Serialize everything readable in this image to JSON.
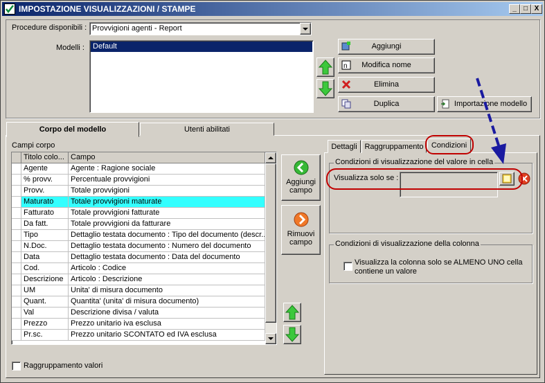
{
  "window": {
    "title": "IMPOSTAZIONE VISUALIZZAZIONI / STAMPE",
    "minimize": "_",
    "maximize": "□",
    "close": "X"
  },
  "top": {
    "procedure_label": "Procedure disponibili :",
    "procedure_value": "Provvigioni agenti - Report",
    "models_label": "Modelli :",
    "models": [
      "Default"
    ],
    "buttons": {
      "add": "Aggiungi",
      "rename": "Modifica nome",
      "delete": "Elimina",
      "duplicate": "Duplica",
      "import": "Importazione modello"
    }
  },
  "tabs": {
    "body": "Corpo del modello",
    "users": "Utenti abilitati"
  },
  "fields": {
    "label": "Campi corpo",
    "col_title": "Titolo colo...",
    "col_field": "Campo",
    "rows": [
      [
        "Agente",
        "Agente : Ragione sociale"
      ],
      [
        "% provv.",
        "Percentuale provvigioni"
      ],
      [
        "Provv.",
        "Totale provvigioni"
      ],
      [
        "Maturato",
        "Totale provvigioni maturate"
      ],
      [
        "Fatturato",
        "Totale provvigioni fatturate"
      ],
      [
        "Da fatt.",
        "Totale provvigioni da fatturare"
      ],
      [
        "Tipo",
        "Dettaglio testata documento : Tipo del documento (descr..."
      ],
      [
        "N.Doc.",
        "Dettaglio testata documento : Numero del documento"
      ],
      [
        "Data",
        "Dettaglio testata documento : Data del documento"
      ],
      [
        "Cod.",
        "Articolo : Codice"
      ],
      [
        "Descrizione",
        "Articolo : Descrizione"
      ],
      [
        "UM",
        "Unita' di misura documento"
      ],
      [
        "Quant.",
        "Quantita' (unita' di misura documento)"
      ],
      [
        "Val",
        "Descrizione divisa / valuta"
      ],
      [
        "Prezzo",
        "Prezzo unitario iva esclusa"
      ],
      [
        "Pr.sc.",
        "Prezzo unitario SCONTATO ed IVA esclusa"
      ]
    ],
    "selected_index": 3,
    "add_field_1": "Aggiungi",
    "add_field_2": "campo",
    "remove_field_1": "Rimuovi",
    "remove_field_2": "campo",
    "grouping": "Raggruppamento valori"
  },
  "detail_tabs": {
    "details": "Dettagli",
    "grouping": "Raggruppamento",
    "conditions": "Condizioni"
  },
  "conditions": {
    "cell_group": "Condizioni di visualizzazione del valore in cella",
    "show_only_if": "Visualizza solo se :",
    "show_only_if_value": "",
    "column_group": "Condizioni di visualizzazione della colonna",
    "column_check_1": "Visualizza la colonna solo se ALMENO UNO cella",
    "column_check_2": "contiene un valore"
  },
  "colors": {
    "selected_row": "#33ffff",
    "annotation_red": "#c00000",
    "annotation_arrow": "#1a1aa0"
  }
}
